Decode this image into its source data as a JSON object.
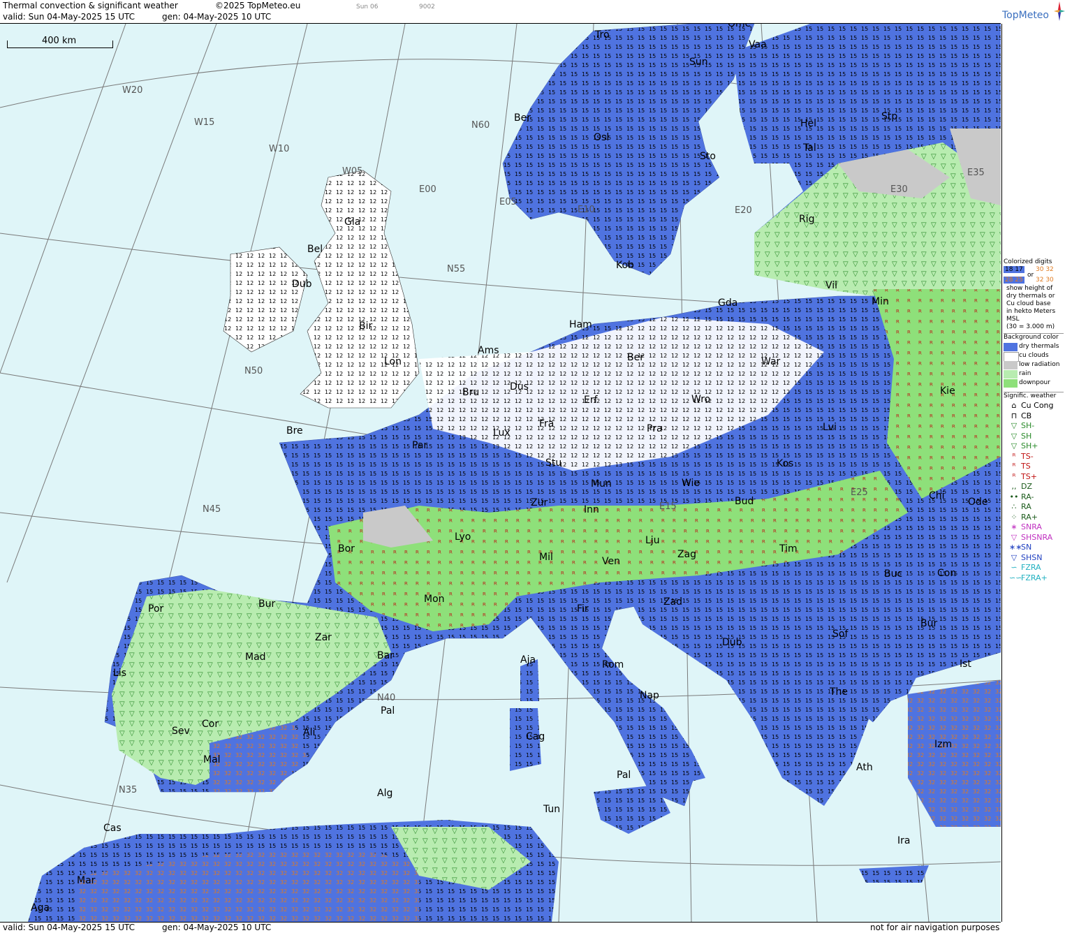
{
  "header": {
    "title": "Thermal convection & significant weather",
    "copyright": "©2025 TopMeteo.eu",
    "valid": "valid:  Sun  04-May-2025  15 UTC",
    "gen": "gen: 04-May-2025 10 UTC",
    "small1": "Sun 06",
    "small2": "9002"
  },
  "logo": {
    "text": "TopMeteo"
  },
  "scale": {
    "label": "400 km"
  },
  "footer": {
    "valid": "valid:  Sun  04-May-2025  15 UTC",
    "gen": "gen: 04-May-2025 10 UTC",
    "note": "not for air navigation purposes"
  },
  "grid_labels": [
    "W20",
    "W15",
    "W10",
    "W05",
    "E00",
    "E05",
    "E10",
    "E15",
    "E20",
    "E25",
    "E30",
    "E35",
    "N60",
    "N55",
    "N50",
    "N45",
    "N40",
    "N35"
  ],
  "cities": [
    "Ome",
    "Tro",
    "Vaa",
    "Sun",
    "Ber",
    "Osl",
    "Sto",
    "Hel",
    "Stp",
    "Tal",
    "Rig",
    "Gla",
    "Bel",
    "Dub",
    "Kob",
    "Vil",
    "Min",
    "Gda",
    "Bir",
    "Ham",
    "Ams",
    "Lon",
    "Ber",
    "War",
    "Dus",
    "Bru",
    "Erf",
    "Wro",
    "Kie",
    "Fra",
    "Lux",
    "Pra",
    "Lvi",
    "Bre",
    "Par",
    "Stu",
    "Kos",
    "Mun",
    "Wie",
    "Chi",
    "Ode",
    "Zur",
    "Inn",
    "Bud",
    "Lyo",
    "Lju",
    "Bor",
    "Mil",
    "Ven",
    "Tim",
    "Zag",
    "Con",
    "Buc",
    "Mon",
    "Fir",
    "Zad",
    "Bur",
    "Por",
    "Zar",
    "Sof",
    "Bur",
    "Dub",
    "Mad",
    "Bar",
    "Aja",
    "Rom",
    "Ist",
    "Lis",
    "Pal",
    "The",
    "Nap",
    "Cor",
    "Cag",
    "Ali",
    "Sev",
    "Izm",
    "Mal",
    "Ath",
    "Pal",
    "Alg",
    "Tun",
    "Cas",
    "Ira",
    "Mar",
    "Aga"
  ],
  "legend": {
    "colorized_title": [
      "Colorized digits"
    ],
    "samples": {
      "a": "18 17",
      "or": "or",
      "b": "30 32",
      "c": "28 25",
      "d": "32 30"
    },
    "explain": [
      "show height of",
      "dry thermals or",
      "Cu cloud base",
      "in hekto Meters",
      "MSL",
      "(30 = 3.000 m)"
    ],
    "bg_title": "Background color",
    "bg_items": [
      {
        "label": "dry thermals",
        "color": "#4f73e0"
      },
      {
        "label": "cu clouds",
        "color": "#ffffff"
      },
      {
        "label": "low radiation",
        "color": "#c9c9c9"
      },
      {
        "label": "rain",
        "color": "#b8ecb0"
      },
      {
        "label": "downpour",
        "color": "#8ee07a"
      }
    ],
    "wx_title": "Signific. weather",
    "wx_items": [
      {
        "label": "Cu Cong",
        "sym": "⌂",
        "color": "#000"
      },
      {
        "label": "CB",
        "sym": "⊓",
        "color": "#000"
      },
      {
        "label": "SH-",
        "sym": "▽",
        "color": "#2a8a2a"
      },
      {
        "label": "SH",
        "sym": "▽",
        "color": "#2a8a2a"
      },
      {
        "label": "SH+",
        "sym": "▽",
        "color": "#2a8a2a"
      },
      {
        "label": "TS-",
        "sym": "ᴿ",
        "color": "#c01010"
      },
      {
        "label": "TS",
        "sym": "ᴿ",
        "color": "#c01010"
      },
      {
        "label": "TS+",
        "sym": "ᴿ",
        "color": "#c01010"
      },
      {
        "label": "DZ",
        "sym": ",,",
        "color": "#1a5a1a"
      },
      {
        "label": "RA-",
        "sym": "••",
        "color": "#1a5a1a"
      },
      {
        "label": "RA",
        "sym": "∴",
        "color": "#1a5a1a"
      },
      {
        "label": "RA+",
        "sym": "⁘",
        "color": "#1a5a1a"
      },
      {
        "label": "SNRA",
        "sym": "∗",
        "color": "#c030c0"
      },
      {
        "label": "SHSNRA",
        "sym": "▽",
        "color": "#c030c0"
      },
      {
        "label": "SN",
        "sym": "∗∗",
        "color": "#2040c0"
      },
      {
        "label": "SHSN",
        "sym": "▽",
        "color": "#2040c0"
      },
      {
        "label": "FZRA",
        "sym": "∽",
        "color": "#20b0c0"
      },
      {
        "label": "FZRA+",
        "sym": "∽∽",
        "color": "#20b0c0"
      }
    ]
  }
}
